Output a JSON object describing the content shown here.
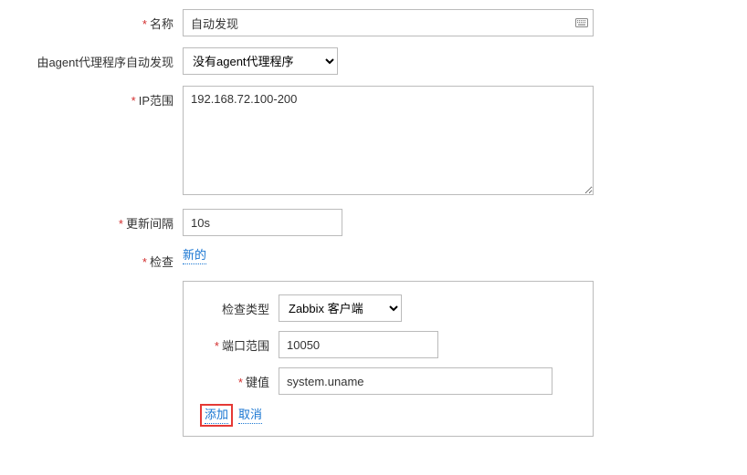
{
  "labels": {
    "name": "名称",
    "agent_discover": "由agent代理程序自动发现",
    "ip_range": "IP范围",
    "update_interval": "更新间隔",
    "check": "检查",
    "check_type": "检查类型",
    "port_range": "端口范围",
    "key": "键值"
  },
  "values": {
    "name": "自动发现",
    "agent_select": "没有agent代理程序",
    "ip_range": "192.168.72.100-200",
    "update_interval": "10s",
    "check_type": "Zabbix 客户端",
    "port_range": "10050",
    "key": "system.uname"
  },
  "links": {
    "newlink": "新的",
    "add": "添加",
    "cancel": "取消"
  }
}
